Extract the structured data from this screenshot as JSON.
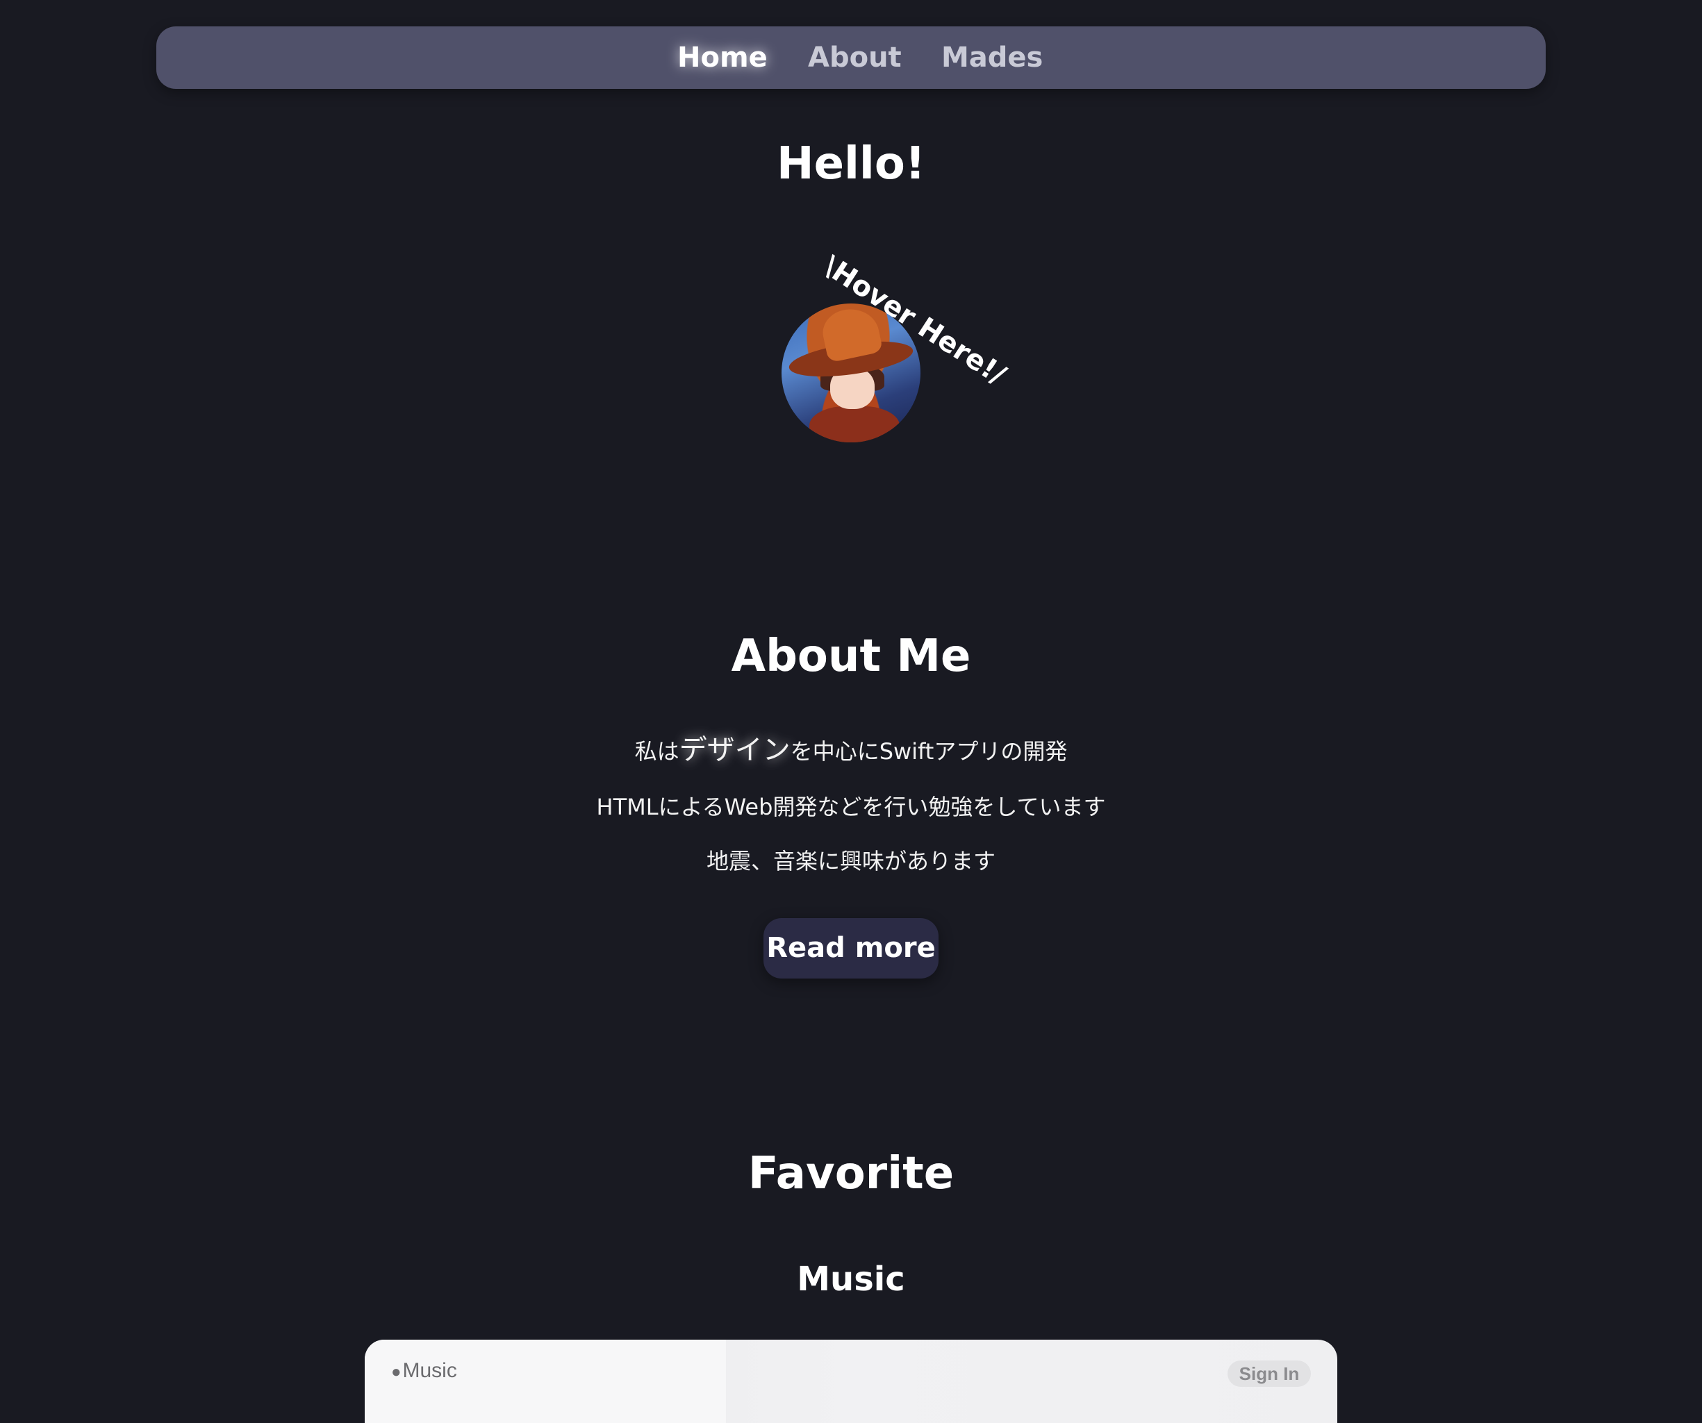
{
  "nav": {
    "items": [
      {
        "label": "Home",
        "active": true
      },
      {
        "label": "About",
        "active": false
      },
      {
        "label": "Mades",
        "active": false
      }
    ]
  },
  "hero": {
    "title": "Hello!",
    "hover_label": "\\Hover Here!/"
  },
  "about": {
    "title": "About Me",
    "line1_prefix": "私は",
    "line1_highlight": "デザイン",
    "line1_suffix": "を中心にSwiftアプリの開発",
    "line2": "HTMLによるWeb開発などを行い勉強をしています",
    "line3": "地震、音楽に興味があります",
    "read_more_label": "Read more"
  },
  "favorite": {
    "title": "Favorite",
    "music_title": "Music"
  },
  "music_embed": {
    "logo_icon": "apple-logo-icon",
    "logo_text": "Music",
    "sign_in_label": "Sign In"
  },
  "colors": {
    "background": "#191a22",
    "nav_background": "#50516a",
    "button_background": "#2b2b45"
  }
}
